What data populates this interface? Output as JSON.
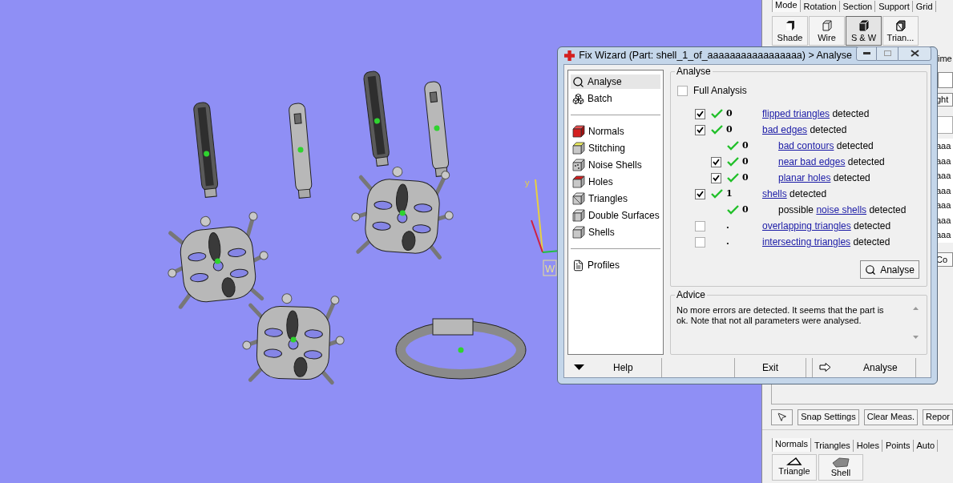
{
  "viewport": {
    "axis_label": "y",
    "view_label": "W"
  },
  "panel": {
    "mode_tabs": [
      {
        "label": "Mode",
        "selected": true
      },
      {
        "label": "Rotation",
        "selected": false
      },
      {
        "label": "Section",
        "selected": false
      },
      {
        "label": "Support",
        "selected": false
      },
      {
        "label": "Grid",
        "selected": false
      }
    ],
    "view_buttons": [
      {
        "label": "Shade",
        "selected": false
      },
      {
        "label": "Wire",
        "selected": false
      },
      {
        "label": "S & W",
        "selected": true
      },
      {
        "label": "Trian...",
        "selected": false
      }
    ],
    "obscured": {
      "text": "ime",
      "button_1": "ght",
      "list_rows": [
        "aaa",
        "aaa",
        "aaa",
        "aaa",
        "aaa",
        "aaa",
        "aaa"
      ],
      "button_2": "Co"
    },
    "measure_buttons": [
      {
        "kind": "pointer"
      },
      {
        "kind": "text",
        "label": "Snap Settings"
      },
      {
        "kind": "text",
        "label": "Clear Meas."
      },
      {
        "kind": "text",
        "label": "Repor"
      }
    ],
    "edit_tabs": [
      {
        "label": "Normals",
        "selected": true
      },
      {
        "label": "Triangles",
        "selected": false
      },
      {
        "label": "Holes",
        "selected": false
      },
      {
        "label": "Points",
        "selected": false
      },
      {
        "label": "Auto",
        "selected": false
      }
    ],
    "edit_buttons": [
      {
        "label": "Triangle"
      },
      {
        "label": "Shell"
      }
    ]
  },
  "dialog": {
    "title": "Fix Wizard (Part: shell_1_of_aaaaaaaaaaaaaaaaa) > Analyse",
    "nav": [
      [
        {
          "label": "Analyse",
          "selected": true
        },
        {
          "label": "Batch",
          "selected": false
        }
      ],
      [
        {
          "label": "Normals",
          "selected": false
        },
        {
          "label": "Stitching",
          "selected": false
        },
        {
          "label": "Noise Shells",
          "selected": false
        },
        {
          "label": "Holes",
          "selected": false
        },
        {
          "label": "Triangles",
          "selected": false
        },
        {
          "label": "Double Surfaces",
          "selected": false
        },
        {
          "label": "Shells",
          "selected": false
        }
      ],
      [
        {
          "label": "Profiles",
          "selected": false
        }
      ]
    ],
    "analyse": {
      "title": "Analyse",
      "full_analysis": {
        "label": "Full Analysis",
        "checked": false
      },
      "results": [
        {
          "kind": "check",
          "checked": true,
          "ok": true,
          "count": "0",
          "link": "flipped triangles",
          "suffix": "detected"
        },
        {
          "kind": "check",
          "checked": true,
          "ok": true,
          "count": "0",
          "link": "bad edges",
          "suffix": "detected",
          "children": [
            {
              "kind": "info",
              "ok": true,
              "count": "0",
              "link": "bad contours",
              "suffix": "detected"
            },
            {
              "kind": "check",
              "checked": true,
              "ok": true,
              "count": "0",
              "link": "near bad edges",
              "suffix": "detected"
            },
            {
              "kind": "check",
              "checked": true,
              "ok": true,
              "count": "0",
              "link": "planar holes",
              "suffix": "detected"
            }
          ]
        },
        {
          "kind": "check",
          "checked": true,
          "ok": true,
          "count": "1",
          "link": "shells",
          "suffix": "detected",
          "children": [
            {
              "kind": "info",
              "ok": true,
              "count": "0",
              "prefix": "possible",
              "link": "noise shells",
              "suffix": "detected"
            }
          ]
        },
        {
          "kind": "check",
          "checked": false,
          "ok": false,
          "count": ".",
          "link": "overlapping triangles",
          "suffix": "detected"
        },
        {
          "kind": "check",
          "checked": false,
          "ok": false,
          "count": ".",
          "link": "intersecting triangles",
          "suffix": "detected"
        }
      ],
      "button": "Analyse"
    },
    "advice": {
      "title": "Advice",
      "text": "No more errors are detected. It seems that the part is ok. Note that not all parameters were analysed."
    },
    "footer": {
      "help": "Help",
      "exit": "Exit",
      "next": "Analyse"
    }
  }
}
